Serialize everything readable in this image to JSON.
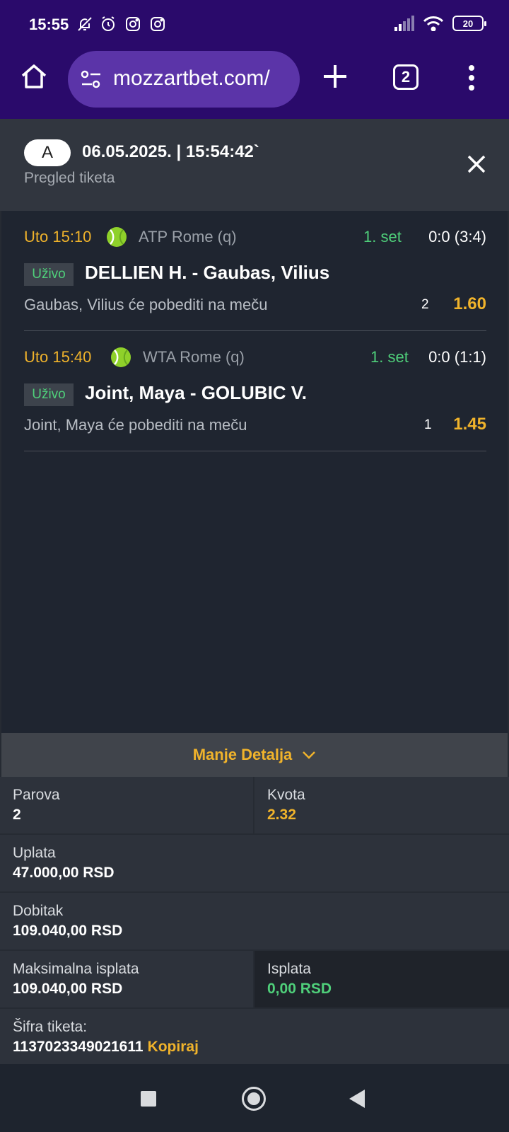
{
  "status_bar": {
    "time": "15:55",
    "battery": "20"
  },
  "browser": {
    "url": "mozzartbet.com/",
    "tab_count": "2"
  },
  "ticket": {
    "type_badge": "A",
    "datetime": "06.05.2025. | 15:54:42`",
    "subtitle": "Pregled tiketa"
  },
  "events": [
    {
      "time": "Uto 15:10",
      "league": "ATP Rome (q)",
      "status": "1. set",
      "score": "0:0 (3:4)",
      "live_label": "Uživo",
      "match": "DELLIEN H. - Gaubas, Vilius",
      "pick": "Gaubas, Vilius će pobediti na meču",
      "pick_code": "2",
      "odd": "1.60"
    },
    {
      "time": "Uto 15:40",
      "league": "WTA Rome (q)",
      "status": "1. set",
      "score": "0:0 (1:1)",
      "live_label": "Uživo",
      "match": "Joint, Maya - GOLUBIC V.",
      "pick": "Joint, Maya će pobediti na meču",
      "pick_code": "1",
      "odd": "1.45"
    }
  ],
  "details": {
    "toggle_label": "Manje Detalja",
    "parova_label": "Parova",
    "parova_value": "2",
    "kvota_label": "Kvota",
    "kvota_value": "2.32",
    "uplata_label": "Uplata",
    "uplata_value": "47.000,00 RSD",
    "dobitak_label": "Dobitak",
    "dobitak_value": "109.040,00 RSD",
    "max_label": "Maksimalna isplata",
    "max_value": "109.040,00 RSD",
    "isplata_label": "Isplata",
    "isplata_value": "0,00 RSD",
    "sifra_label": "Šifra tiketa:",
    "sifra_value": "1137023349021611",
    "copy_label": "Kopiraj"
  },
  "colors": {
    "accent": "#f0b32b",
    "live_green": "#4fcf7a",
    "chrome": "#2a0a6b"
  }
}
